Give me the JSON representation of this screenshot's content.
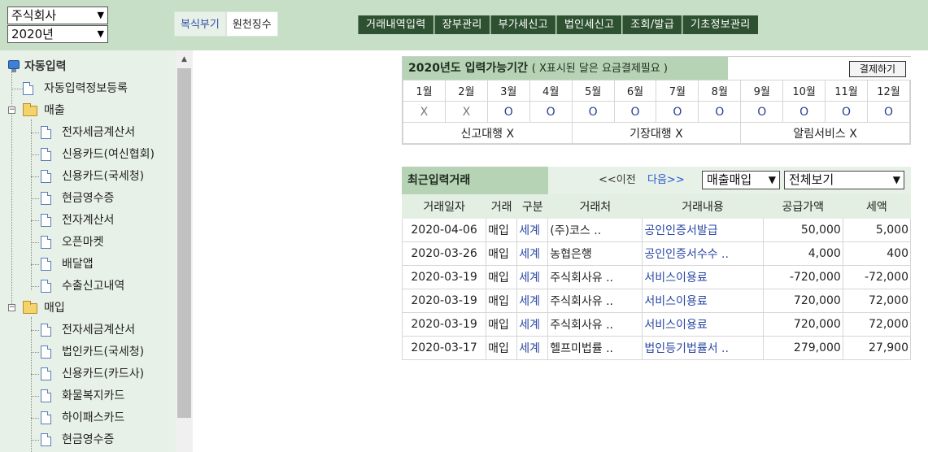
{
  "company_select": "주식회사",
  "year_select": "2020년",
  "sub_tabs": [
    "복식부기",
    "원천징수"
  ],
  "main_nav": [
    "거래내역입력",
    "장부관리",
    "부가세신고",
    "법인세신고",
    "조회/발급",
    "기초정보관리"
  ],
  "sidebar": {
    "root_label": "자동입력",
    "register_label": "자동입력정보등록",
    "sales_label": "매출",
    "sales_items": [
      "전자세금계산서",
      "신용카드(여신협회)",
      "신용카드(국세청)",
      "현금영수증",
      "전자계산서",
      "오픈마켓",
      "배달앱",
      "수출신고내역"
    ],
    "purchase_label": "매입",
    "purchase_items": [
      "전자세금계산서",
      "법인카드(국세청)",
      "신용카드(카드사)",
      "화물복지카드",
      "하이패스카드",
      "현금영수증"
    ]
  },
  "period": {
    "title": "2020년도 입력가능기간",
    "note": "( X표시된 달은 요금결제필요 )",
    "pay_button": "결제하기",
    "months": [
      "1월",
      "2월",
      "3월",
      "4월",
      "5월",
      "6월",
      "7월",
      "8월",
      "9월",
      "10월",
      "11월",
      "12월"
    ],
    "marks": [
      "X",
      "X",
      "O",
      "O",
      "O",
      "O",
      "O",
      "O",
      "O",
      "O",
      "O",
      "O"
    ],
    "services": [
      "신고대행 X",
      "기장대행 X",
      "알림서비스 X"
    ]
  },
  "recent": {
    "title": "최근입력거래",
    "prev": "<<이전",
    "next": "다음>>",
    "filter_type": "매출매입",
    "filter_view": "전체보기",
    "columns": [
      "거래일자",
      "거래",
      "구분",
      "거래처",
      "거래내용",
      "공급가액",
      "세액"
    ],
    "rows": [
      [
        "2020-04-06",
        "매입",
        "세계",
        "(주)코스 ..",
        "공인인증서발급",
        "50,000",
        "5,000"
      ],
      [
        "2020-03-26",
        "매입",
        "세계",
        "농협은행",
        "공인인증서수수 ..",
        "4,000",
        "400"
      ],
      [
        "2020-03-19",
        "매입",
        "세계",
        "주식회사유 ..",
        "서비스이용료",
        "-720,000",
        "-72,000"
      ],
      [
        "2020-03-19",
        "매입",
        "세계",
        "주식회사유 ..",
        "서비스이용료",
        "720,000",
        "72,000"
      ],
      [
        "2020-03-19",
        "매입",
        "세계",
        "주식회사유 ..",
        "서비스이용료",
        "720,000",
        "72,000"
      ],
      [
        "2020-03-17",
        "매입",
        "세계",
        "헬프미법률 ..",
        "법인등기법률서 ..",
        "279,000",
        "27,900"
      ]
    ]
  }
}
